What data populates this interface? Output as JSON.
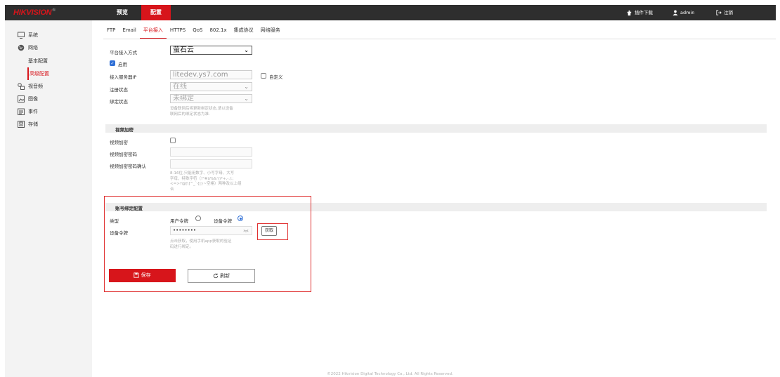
{
  "header": {
    "logo": "HIKVISION",
    "logo_mark": "®",
    "nav": {
      "preview": "预览",
      "config": "配置"
    },
    "plugin_download": "插件下载",
    "user": "admin",
    "logout": "注销"
  },
  "sidebar": {
    "items": [
      {
        "label": "系统",
        "icon": "monitor-icon"
      },
      {
        "label": "网络",
        "icon": "globe-icon"
      },
      {
        "label": "基本配置",
        "icon": ""
      },
      {
        "label": "高级配置",
        "icon": ""
      },
      {
        "label": "视音频",
        "icon": "audio-video-icon"
      },
      {
        "label": "图像",
        "icon": "image-icon"
      },
      {
        "label": "事件",
        "icon": "calendar-icon"
      },
      {
        "label": "存储",
        "icon": "storage-icon"
      }
    ],
    "active": "高级配置"
  },
  "tabs": [
    "FTP",
    "Email",
    "平台接入",
    "HTTPS",
    "QoS",
    "802.1x",
    "集成协议",
    "网络服务"
  ],
  "active_tab": "平台接入",
  "form": {
    "platform_access_label": "平台接入方式",
    "platform_access_value": "萤石云",
    "enable_label": "启用",
    "enable_checked": true,
    "server_ip_label": "接入服务器IP",
    "server_ip_value": "litedev.ys7.com",
    "custom_label": "自定义",
    "register_status_label": "注册状态",
    "register_status_value": "在线",
    "bind_status_label": "绑定状态",
    "bind_status_value": "未绑定",
    "bind_hint_1": "设备联网后将更新绑定状态,请以设备",
    "bind_hint_2": "联网后的绑定状态为准."
  },
  "video_encryption": {
    "section_title": "视频加密",
    "encrypt_label": "视频加密",
    "password_label": "视频加密密码",
    "confirm_label": "视频加密密码确认",
    "hint_1": "8-16位,只能用数字、小写字母、大写",
    "hint_2": "字母、特殊字符（!\"#$%&'()*+,-./:;",
    "hint_3": "<=>?@[\\]^_`{|}~空格）两种及以上组",
    "hint_4": "合"
  },
  "account_binding": {
    "section_title": "账号绑定配置",
    "type_label": "类型",
    "user_token": "用户令牌",
    "device_token": "设备令牌",
    "device_token_label": "设备令牌",
    "token_value": "••••••••",
    "get_button": "获取",
    "hint_1": "点击获取，使用手机app获取的验证",
    "hint_2": "码进行绑定。"
  },
  "buttons": {
    "save": "保存",
    "refresh": "刷新"
  },
  "footer": "©2022 Hikvision Digital Technology Co., Ltd. All Rights Reserved.",
  "colors": {
    "brand_red": "#d7151b",
    "topbar": "#2e2e2e",
    "highlight_box": "#e03030",
    "radio_blue": "#2f6fd6"
  }
}
